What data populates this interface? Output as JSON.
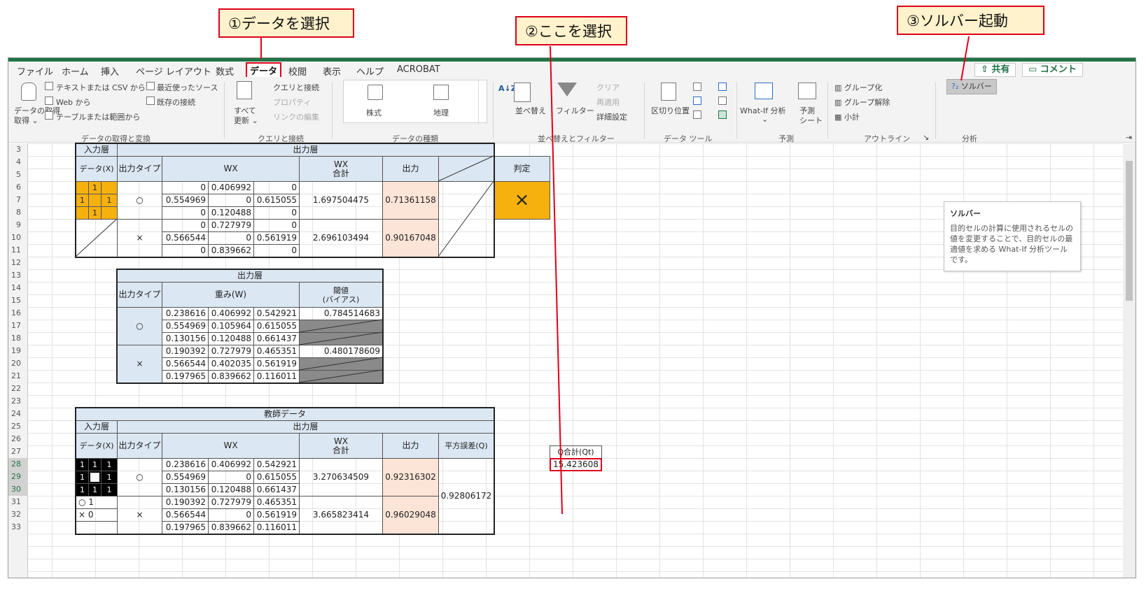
{
  "callouts": {
    "c1": "①データを選択",
    "c2": "②ここを選択",
    "c3": "③ソルバー起動"
  },
  "menu": {
    "tabs": [
      "ファイル",
      "ホーム",
      "挿入",
      "ページ レイアウト",
      "数式",
      "データ",
      "校閲",
      "表示",
      "ヘルプ",
      "ACROBAT"
    ],
    "share": "⇧ 共有",
    "comment": "▭ コメント"
  },
  "ribbon": {
    "get_data": "データの取得",
    "get_data2": "取得 ⌄",
    "text_csv": "テキストまたは CSV から",
    "web": "Web から",
    "table_range": "テーブルまたは範囲から",
    "recent": "最近使ったソース",
    "existing": "既存の接続",
    "group1": "データの取得と変換",
    "refresh_all": "すべて",
    "refresh_all2": "更新 ⌄",
    "queries": "クエリと接続",
    "properties": "プロパティ",
    "edit_links": "リンクの編集",
    "group2": "クエリと接続",
    "stocks": "株式",
    "geo": "地理",
    "group3": "データの種類",
    "sort": "並べ替え",
    "filter": "フィルター",
    "clear": "クリア",
    "reapply": "再適用",
    "advanced": "詳細設定",
    "group4": "並べ替えとフィルター",
    "text_to_col": "区切り位置",
    "group5": "データ ツール",
    "whatif": "What-If 分析",
    "whatif2": "⌄",
    "forecast": "予測",
    "forecast2": "シート",
    "group6": "予測",
    "group_btn": "グループ化",
    "ungroup": "グループ解除",
    "subtotal": "小計",
    "group7": "アウトライン",
    "solver": "ソルバー",
    "group8": "分析"
  },
  "tooltip": {
    "title": "ソルバー",
    "body": "目的セルの計算に使用されるセルの値を変更することで、目的セルの最適値を求める What-If 分析ツールです。"
  },
  "rows": [
    "3",
    "4",
    "5",
    "6",
    "7",
    "8",
    "9",
    "10",
    "11",
    "12",
    "13",
    "14",
    "15",
    "16",
    "17",
    "18",
    "19",
    "20",
    "21",
    "22",
    "23",
    "24",
    "25",
    "26",
    "27",
    "28",
    "29",
    "30",
    "31",
    "32",
    "33"
  ],
  "t1": {
    "in_layer": "入力層",
    "out_layer": "出力層",
    "data_x": "データ(X)",
    "out_type": "出力タイプ",
    "wx": "WX",
    "wx_sum1": "WX",
    "wx_sum2": "合計",
    "out": "出力",
    "judge": "判定",
    "grid_ones": [
      "1",
      "1",
      "1",
      "1"
    ],
    "o_type": "○",
    "x_type": "×",
    "o_rows": [
      [
        "0",
        "0.406992",
        "0"
      ],
      [
        "0.554969",
        "0",
        "0.615055"
      ],
      [
        "0",
        "0.120488",
        "0"
      ]
    ],
    "x_rows": [
      [
        "0",
        "0.727979",
        "0"
      ],
      [
        "0.566544",
        "0",
        "0.561919"
      ],
      [
        "0",
        "0.839662",
        "0"
      ]
    ],
    "o_sum": "1.697504475",
    "x_sum": "2.696103494",
    "o_out": "0.71361158",
    "x_out": "0.90167048",
    "judge_val": "×"
  },
  "t2": {
    "title": "出力層",
    "out_type": "出力タイプ",
    "weight": "重み(W)",
    "thr1": "閾値",
    "thr2": "(バイアス)",
    "o_type": "○",
    "x_type": "×",
    "o_rows": [
      [
        "0.238616",
        "0.406992",
        "0.542921"
      ],
      [
        "0.554969",
        "0.105964",
        "0.615055"
      ],
      [
        "0.130156",
        "0.120488",
        "0.661437"
      ]
    ],
    "x_rows": [
      [
        "0.190392",
        "0.727979",
        "0.465351"
      ],
      [
        "0.566544",
        "0.402035",
        "0.561919"
      ],
      [
        "0.197965",
        "0.839662",
        "0.116011"
      ]
    ],
    "o_bias": "0.784514683",
    "x_bias": "0.480178609"
  },
  "t3": {
    "title": "教師データ",
    "in_layer": "入力層",
    "out_layer": "出力層",
    "data_x": "データ(X)",
    "out_type": "出力タイプ",
    "wx": "WX",
    "wx_sum1": "WX",
    "wx_sum2": "合計",
    "out": "出力",
    "sq_err": "平方誤差(Q)",
    "grid": [
      "1",
      "1",
      "1",
      "1",
      "1",
      "1",
      "1",
      "1"
    ],
    "legend_o": "○ 1",
    "legend_x": "× 0",
    "o_type": "○",
    "x_type": "×",
    "o_rows": [
      [
        "0.238616",
        "0.406992",
        "0.542921"
      ],
      [
        "0.554969",
        "0",
        "0.615055"
      ],
      [
        "0.130156",
        "0.120488",
        "0.661437"
      ]
    ],
    "x_rows": [
      [
        "0.190392",
        "0.727979",
        "0.465351"
      ],
      [
        "0.566544",
        "0",
        "0.561919"
      ],
      [
        "0.197965",
        "0.839662",
        "0.116011"
      ]
    ],
    "o_sum": "3.270634509",
    "x_sum": "3.665823414",
    "o_out": "0.92316302",
    "x_out": "0.96029048",
    "sq_err_val": "0.92806172"
  },
  "qsum": {
    "label": "Q合計(Qt)",
    "value": "15.423608"
  }
}
